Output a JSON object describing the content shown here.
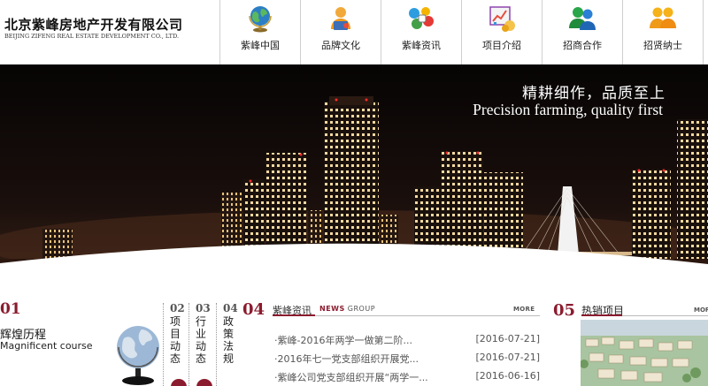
{
  "logo": {
    "name_cn": "北京紫峰房地产开发有限公司",
    "name_en": "BEIJING ZIFENG REAL ESTATE DEVELOPMENT CO., LTD."
  },
  "nav": {
    "items": [
      {
        "label": "紫峰中国",
        "icon": "globe-icon"
      },
      {
        "label": "品牌文化",
        "icon": "user-award-icon"
      },
      {
        "label": "紫峰资讯",
        "icon": "news-icon"
      },
      {
        "label": "项目介绍",
        "icon": "chart-icon"
      },
      {
        "label": "招商合作",
        "icon": "messenger-people-icon"
      },
      {
        "label": "招贤纳士",
        "icon": "team-people-icon"
      }
    ]
  },
  "banner": {
    "slogan_cn": "精耕细作，品质至上",
    "slogan_en": "Precision farming, quality first"
  },
  "history": {
    "number": "01",
    "title": "辉煌历程",
    "subtitle": "Magnificent course"
  },
  "vertical_tabs": [
    {
      "number": "02",
      "label": "项目动态"
    },
    {
      "number": "03",
      "label": "行业动态"
    },
    {
      "number": "04",
      "label": "政策法规"
    }
  ],
  "news": {
    "number": "04",
    "title": "紫峰资讯",
    "en_highlight": "NEWS",
    "en_rest": "GROUP",
    "more": "MORE",
    "items": [
      {
        "title": "·紫峰-2016年两学一做第二阶...",
        "date": "[2016-07-21]"
      },
      {
        "title": "·2016年七一党支部组织开展党...",
        "date": "[2016-07-21]"
      },
      {
        "title": "·紫峰公司党支部组织开展“两学一...",
        "date": "[2016-06-16]"
      }
    ]
  },
  "hot": {
    "number": "05",
    "title": "热销项目",
    "more": "MORE"
  },
  "colors": {
    "accent": "#8b1b2e",
    "banner_bg": "#0b0706"
  }
}
